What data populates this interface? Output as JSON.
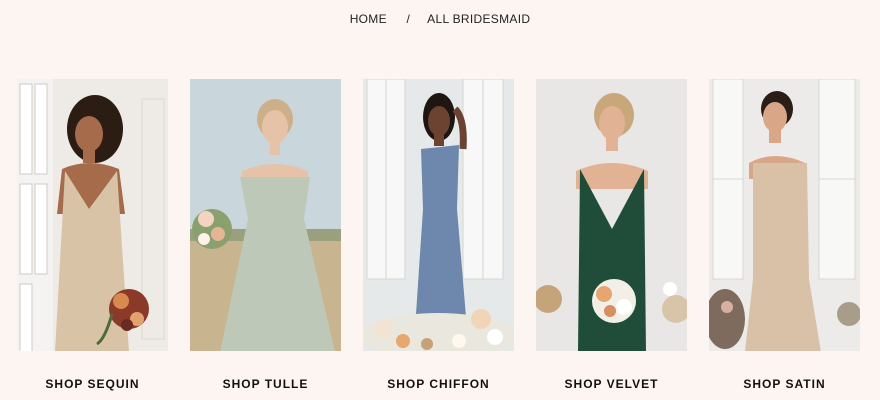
{
  "breadcrumb": {
    "home": "HOME",
    "separator": "/",
    "current": "ALL BRIDESMAID"
  },
  "categories": [
    {
      "label": "SHOP SEQUIN",
      "dress_color": "#d9c3a6",
      "bg_color": "#eeeae6"
    },
    {
      "label": "SHOP TULLE",
      "dress_color": "#bdc8b8",
      "bg_color": "#c9d6dc"
    },
    {
      "label": "SHOP CHIFFON",
      "dress_color": "#6d87ad",
      "bg_color": "#e6e9e9"
    },
    {
      "label": "SHOP VELVET",
      "dress_color": "#1f4d3a",
      "bg_color": "#e8e7e5"
    },
    {
      "label": "SHOP SATIN",
      "dress_color": "#d8c1a6",
      "bg_color": "#ecebea"
    }
  ]
}
